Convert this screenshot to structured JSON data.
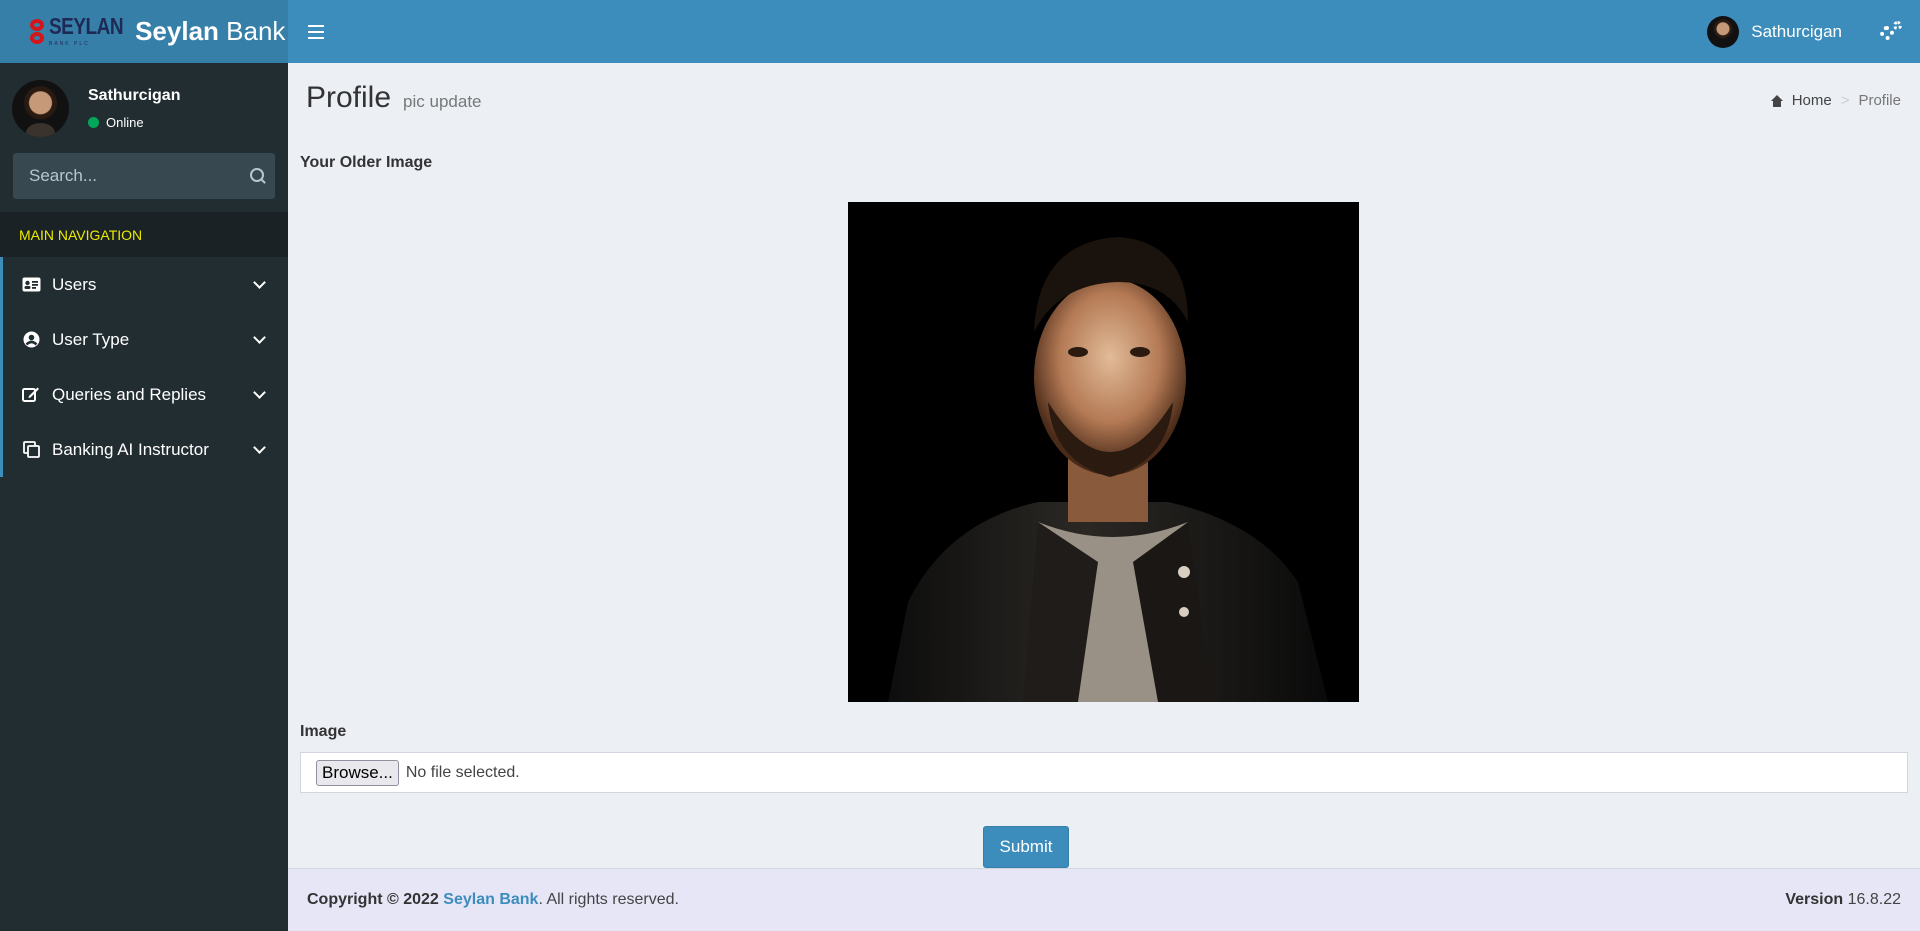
{
  "brand": {
    "logo_text": "SEYLAN",
    "logo_subtext": "BANK PLC",
    "title_bold": "Seylan",
    "title_light": "Bank"
  },
  "user": {
    "name": "Sathurcigan",
    "status": "Online"
  },
  "search": {
    "placeholder": "Search..."
  },
  "nav": {
    "header": "MAIN NAVIGATION",
    "items": [
      {
        "label": "Users",
        "icon": "id-card-icon"
      },
      {
        "label": "User Type",
        "icon": "user-circle-icon"
      },
      {
        "label": "Queries and Replies",
        "icon": "edit-icon"
      },
      {
        "label": "Banking AI Instructor",
        "icon": "copy-icon"
      }
    ]
  },
  "page": {
    "title": "Profile",
    "subtitle": "pic update",
    "breadcrumb": {
      "home": "Home",
      "current": "Profile"
    },
    "older_image_label": "Your Older Image",
    "image_label": "Image",
    "browse_label": "Browse...",
    "file_status": "No file selected.",
    "submit_label": "Submit"
  },
  "footer": {
    "copyright_prefix": "Copyright © 2022",
    "brand": "Seylan Bank",
    "suffix": ". All rights reserved.",
    "version_label": "Version",
    "version": "16.8.22"
  },
  "colors": {
    "header": "#3c8dbc",
    "sidebar": "#222d32",
    "accent": "#3c8dbc",
    "online": "#00a65a"
  }
}
